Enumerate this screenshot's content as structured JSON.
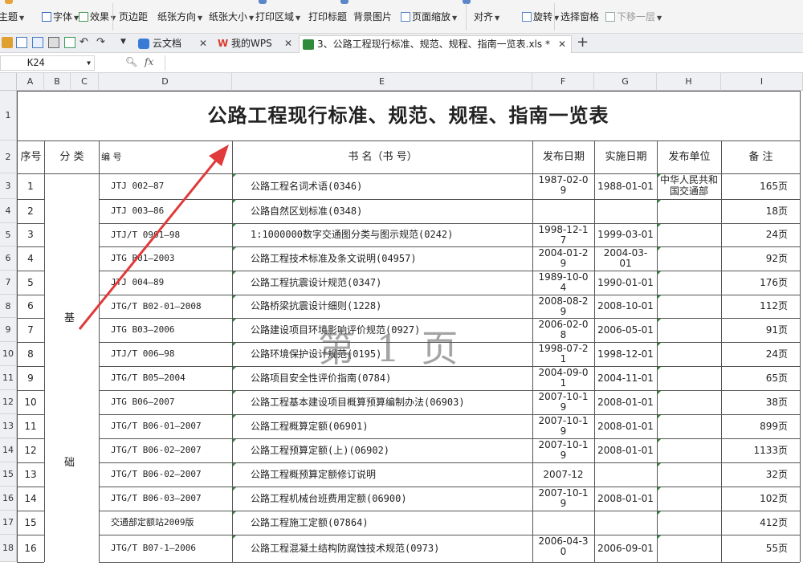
{
  "ribbon": {
    "items": [
      {
        "label": "主题",
        "icon": "theme-icon"
      },
      {
        "label": "字体",
        "icon": "font-icon"
      },
      {
        "label": "效果",
        "icon": "effect-icon"
      },
      {
        "label": "页边距",
        "icon": "margin-icon"
      },
      {
        "label": "纸张方向",
        "icon": "orientation-icon"
      },
      {
        "label": "纸张大小",
        "icon": "paper-size-icon"
      },
      {
        "label": "打印区域",
        "icon": "print-area-icon"
      },
      {
        "label": "打印标题",
        "icon": "print-title-icon"
      },
      {
        "label": "背景图片",
        "icon": "background-icon"
      },
      {
        "label": "页面缩放",
        "icon": "zoom-icon"
      },
      {
        "label": "对齐",
        "icon": "align-icon"
      },
      {
        "label": "旋转",
        "icon": "rotate-icon"
      },
      {
        "label": "选择窗格",
        "icon": "selection-pane-icon"
      },
      {
        "label": "下移一层",
        "icon": "send-backward-icon"
      }
    ]
  },
  "tabs": [
    {
      "label": "云文档",
      "icon": "cloud-doc-icon"
    },
    {
      "label": "我的WPS",
      "icon": "wps-logo-icon"
    },
    {
      "label": "3、公路工程现行标准、规范、规程、指南一览表.xls *",
      "icon": "sheet-file-icon"
    }
  ],
  "formula_bar": {
    "cell_ref": "K24",
    "fx": "fx",
    "value": ""
  },
  "columns": [
    "A",
    "B",
    "C",
    "D",
    "E",
    "F",
    "G",
    "H",
    "I"
  ],
  "sheet": {
    "title": "公路工程现行标准、规范、规程、指南一览表",
    "headers": {
      "no": "序号",
      "cat": "分 类",
      "code": "编    号",
      "name": "书                  名（书    号）",
      "pub": "发布日期",
      "impl": "实施日期",
      "org": "发布单位",
      "note": "备  注"
    },
    "category_chars": [
      "基",
      "础"
    ],
    "watermark": "第 1 页",
    "row_numbers": [
      "1",
      "2",
      "3",
      "4",
      "5",
      "6",
      "7",
      "8",
      "9",
      "10",
      "11",
      "12",
      "13",
      "14",
      "15",
      "16",
      "17",
      "18"
    ],
    "rows": [
      {
        "no": "1",
        "code": "JTJ 002—87",
        "name": "公路工程名词术语(0346)",
        "pub": "1987-02-09",
        "impl": "1988-01-01",
        "org": "中华人民共和国交通部",
        "note": "165页"
      },
      {
        "no": "2",
        "code": "JTJ 003—86",
        "name": "公路自然区划标准(0348)",
        "pub": "",
        "impl": "",
        "org": "",
        "note": "18页"
      },
      {
        "no": "3",
        "code": "JTJ/T 0901—98",
        "name": "1:1000000数字交通图分类与图示规范(0242)",
        "pub": "1998-12-17",
        "impl": "1999-03-01",
        "org": "",
        "note": "24页"
      },
      {
        "no": "4",
        "code": "JTG B01—2003",
        "name": "公路工程技术标准及条文说明(04957)",
        "pub": "2004-01-29",
        "impl": "2004-03-01",
        "org": "",
        "note": "92页"
      },
      {
        "no": "5",
        "code": "JTJ 004—89",
        "name": "公路工程抗震设计规范(0347)",
        "pub": "1989-10-04",
        "impl": "1990-01-01",
        "org": "",
        "note": "176页"
      },
      {
        "no": "6",
        "code": "JTG/T B02-01—2008",
        "name": "公路桥梁抗震设计细则(1228)",
        "pub": "2008-08-29",
        "impl": "2008-10-01",
        "org": "",
        "note": "112页"
      },
      {
        "no": "7",
        "code": "JTG B03—2006",
        "name": "公路建设项目环境影响评价规范(0927)",
        "pub": "2006-02-08",
        "impl": "2006-05-01",
        "org": "",
        "note": "91页"
      },
      {
        "no": "8",
        "code": "JTJ/T 006—98",
        "name": "公路环境保护设计规范(0195)",
        "pub": "1998-07-21",
        "impl": "1998-12-01",
        "org": "",
        "note": "24页"
      },
      {
        "no": "9",
        "code": "JTG/T B05—2004",
        "name": "公路项目安全性评价指南(0784)",
        "pub": "2004-09-01",
        "impl": "2004-11-01",
        "org": "",
        "note": "65页"
      },
      {
        "no": "10",
        "code": "JTG B06—2007",
        "name": "公路工程基本建设项目概算预算编制办法(06903)",
        "pub": "2007-10-19",
        "impl": "2008-01-01",
        "org": "",
        "note": "38页"
      },
      {
        "no": "11",
        "code": "JTG/T B06-01—2007",
        "name": "公路工程概算定额(06901)",
        "pub": "2007-10-19",
        "impl": "2008-01-01",
        "org": "",
        "note": "899页"
      },
      {
        "no": "12",
        "code": "JTG/T B06-02—2007",
        "name": "公路工程预算定额(上)(06902)",
        "pub": "2007-10-19",
        "impl": "2008-01-01",
        "org": "",
        "note": "1133页"
      },
      {
        "no": "13",
        "code": "JTG/T B06-02—2007",
        "name": "公路工程概预算定额修订说明",
        "pub": "2007-12",
        "impl": "",
        "org": "",
        "note": "32页"
      },
      {
        "no": "14",
        "code": "JTG/T B06-03—2007",
        "name": "公路工程机械台班费用定额(06900)",
        "pub": "2007-10-19",
        "impl": "2008-01-01",
        "org": "",
        "note": "102页"
      },
      {
        "no": "15",
        "code": "交通部定额站2009版",
        "name": "公路工程施工定额(07864)",
        "pub": "",
        "impl": "",
        "org": "",
        "note": "412页"
      },
      {
        "no": "16",
        "code": "JTG/T B07-1—2006",
        "name": "公路工程混凝土结构防腐蚀技术规范(0973)",
        "pub": "2006-04-30",
        "impl": "2006-09-01",
        "org": "",
        "note": "55页"
      }
    ]
  },
  "colors": {
    "arrow": "#e03a3a",
    "accent": "#2e8b3a",
    "header_bg": "#eef0f3"
  }
}
